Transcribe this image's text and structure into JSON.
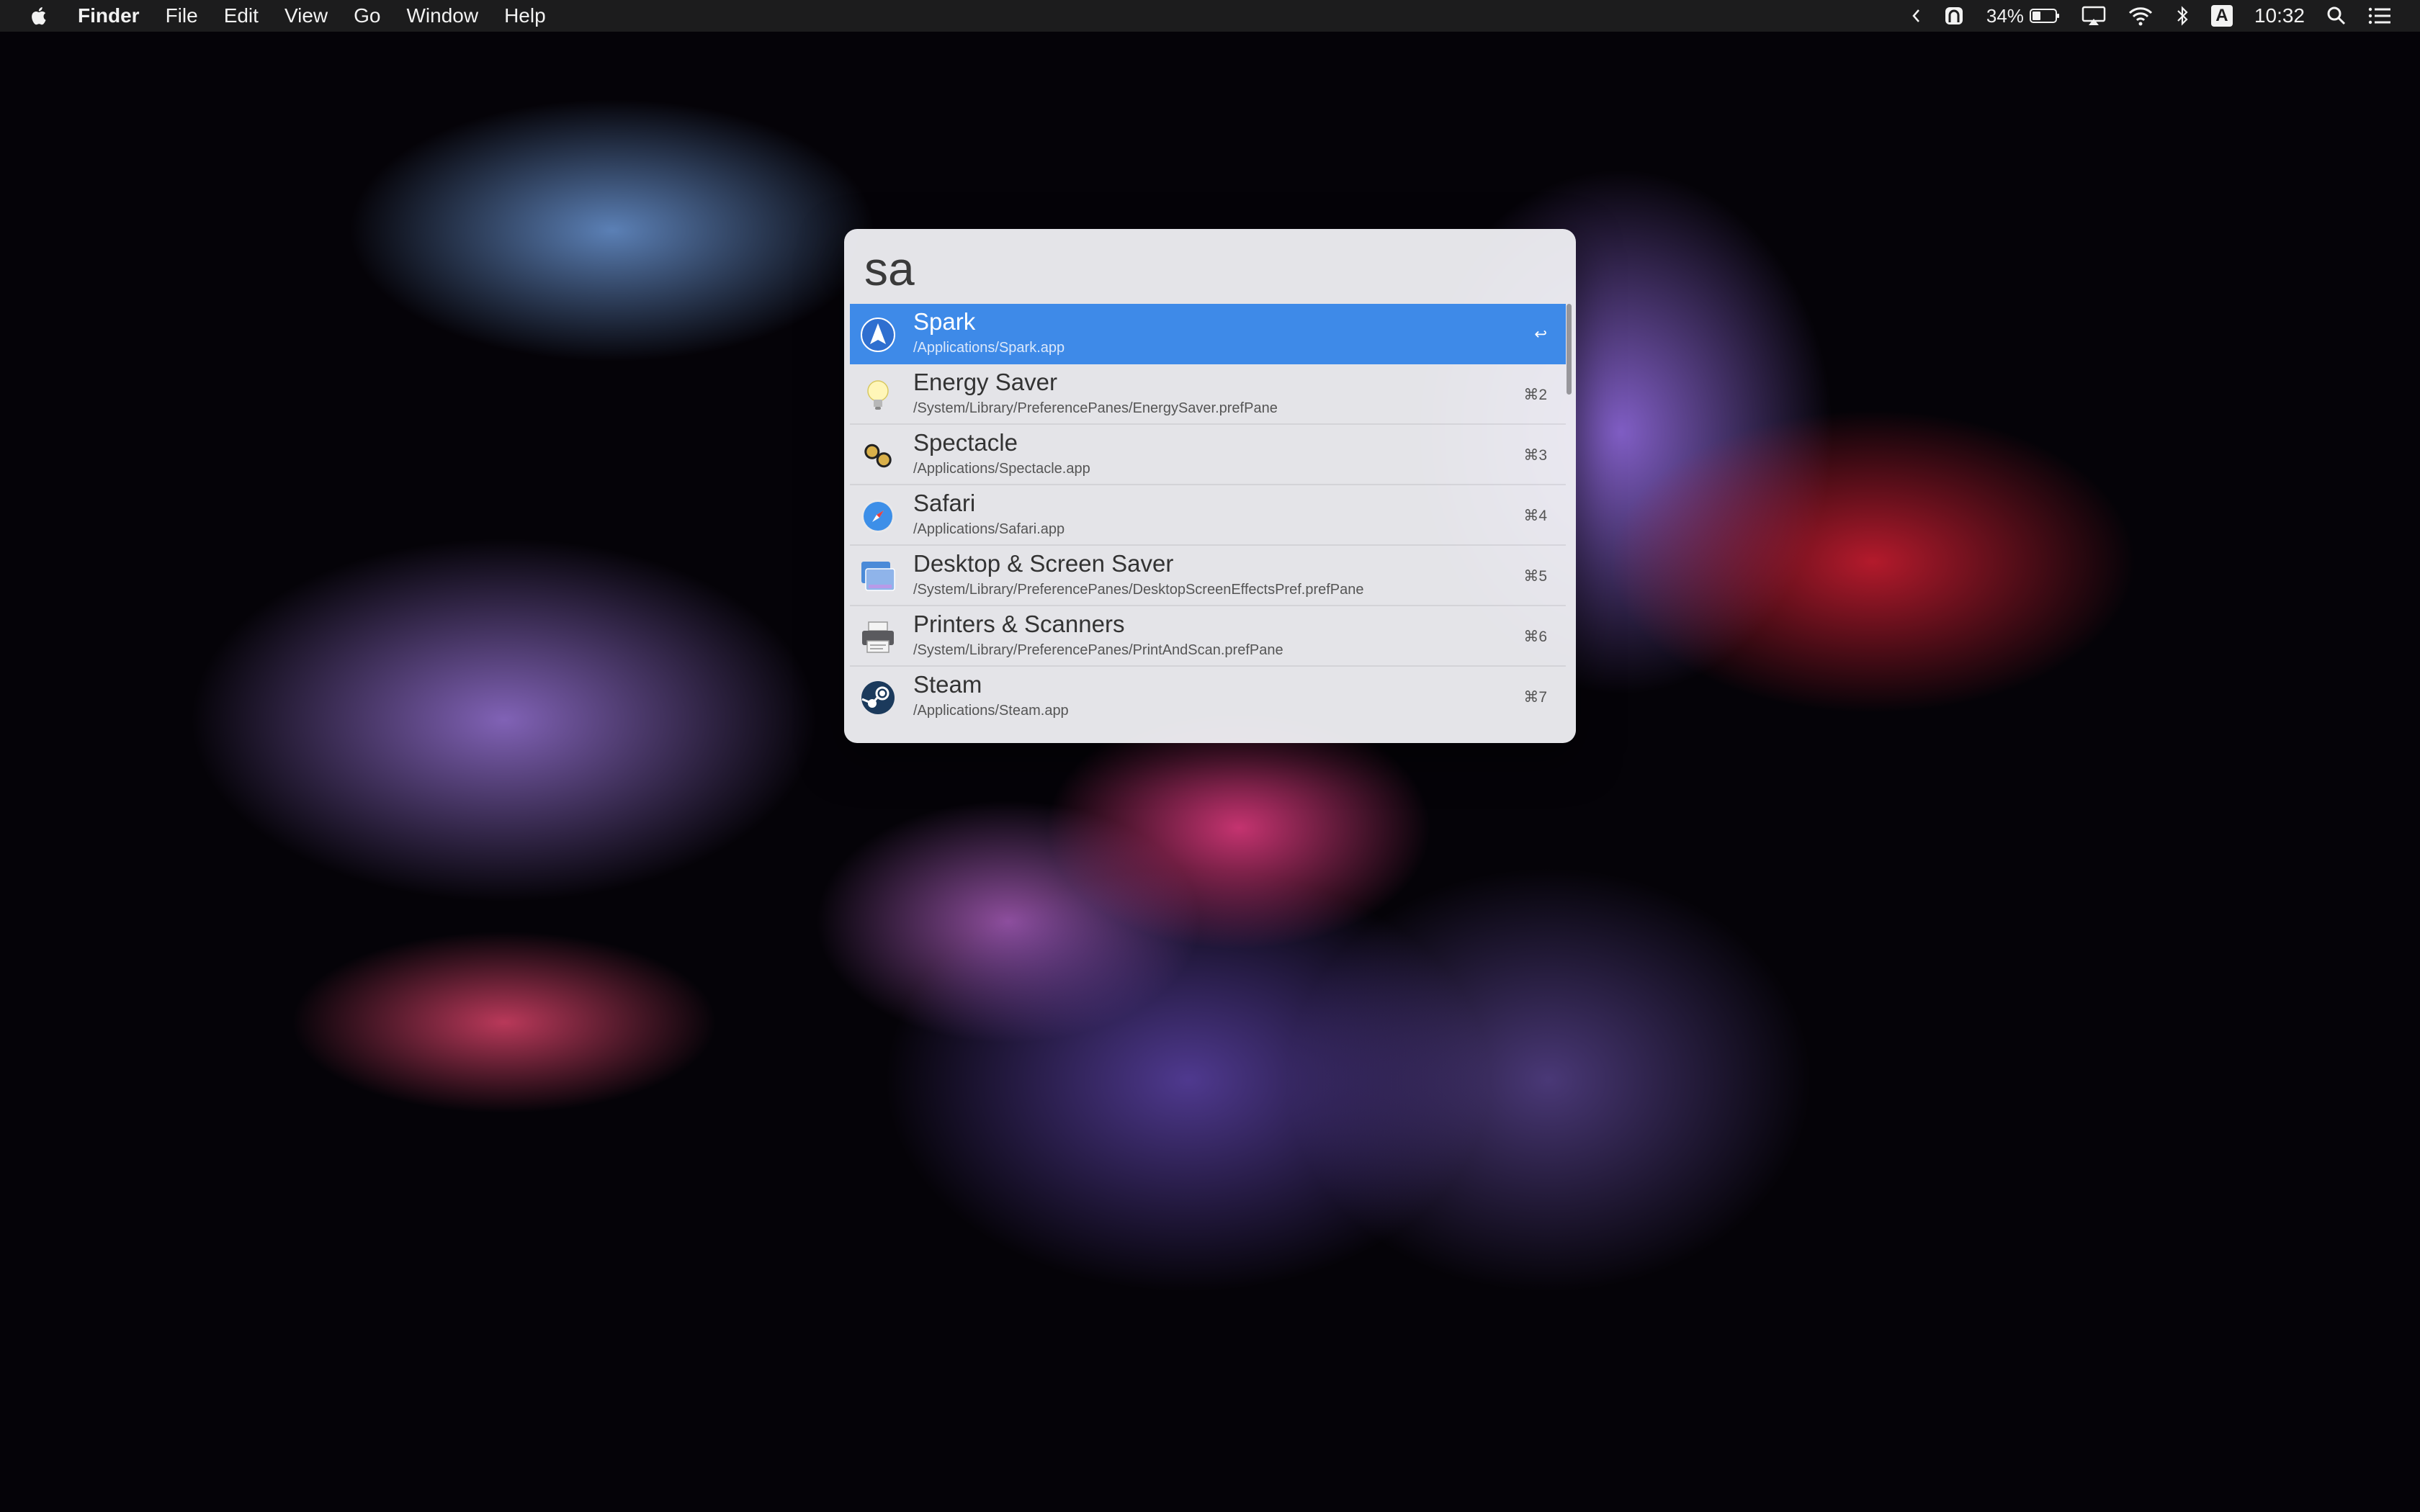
{
  "menubar": {
    "app_name": "Finder",
    "menus": [
      "File",
      "Edit",
      "View",
      "Go",
      "Window",
      "Help"
    ],
    "status": {
      "battery_percent": "34%",
      "input_source": "A",
      "clock": "10:32"
    }
  },
  "launcher": {
    "query": "sa",
    "results": [
      {
        "title": "Spark",
        "path": "/Applications/Spark.app",
        "shortcut": "↩",
        "icon": "spark-icon",
        "selected": true
      },
      {
        "title": "Energy Saver",
        "path": "/System/Library/PreferencePanes/EnergySaver.prefPane",
        "shortcut": "⌘2",
        "icon": "lightbulb-icon"
      },
      {
        "title": "Spectacle",
        "path": "/Applications/Spectacle.app",
        "shortcut": "⌘3",
        "icon": "glasses-icon"
      },
      {
        "title": "Safari",
        "path": "/Applications/Safari.app",
        "shortcut": "⌘4",
        "icon": "safari-compass-icon"
      },
      {
        "title": "Desktop & Screen Saver",
        "path": "/System/Library/PreferencePanes/DesktopScreenEffectsPref.prefPane",
        "shortcut": "⌘5",
        "icon": "desktop-screensaver-icon"
      },
      {
        "title": "Printers & Scanners",
        "path": "/System/Library/PreferencePanes/PrintAndScan.prefPane",
        "shortcut": "⌘6",
        "icon": "printer-icon"
      },
      {
        "title": "Steam",
        "path": "/Applications/Steam.app",
        "shortcut": "⌘7",
        "icon": "steam-icon"
      }
    ]
  },
  "colors": {
    "selection": "#3e8ae8",
    "menubar_bg": "#1e1e20"
  }
}
